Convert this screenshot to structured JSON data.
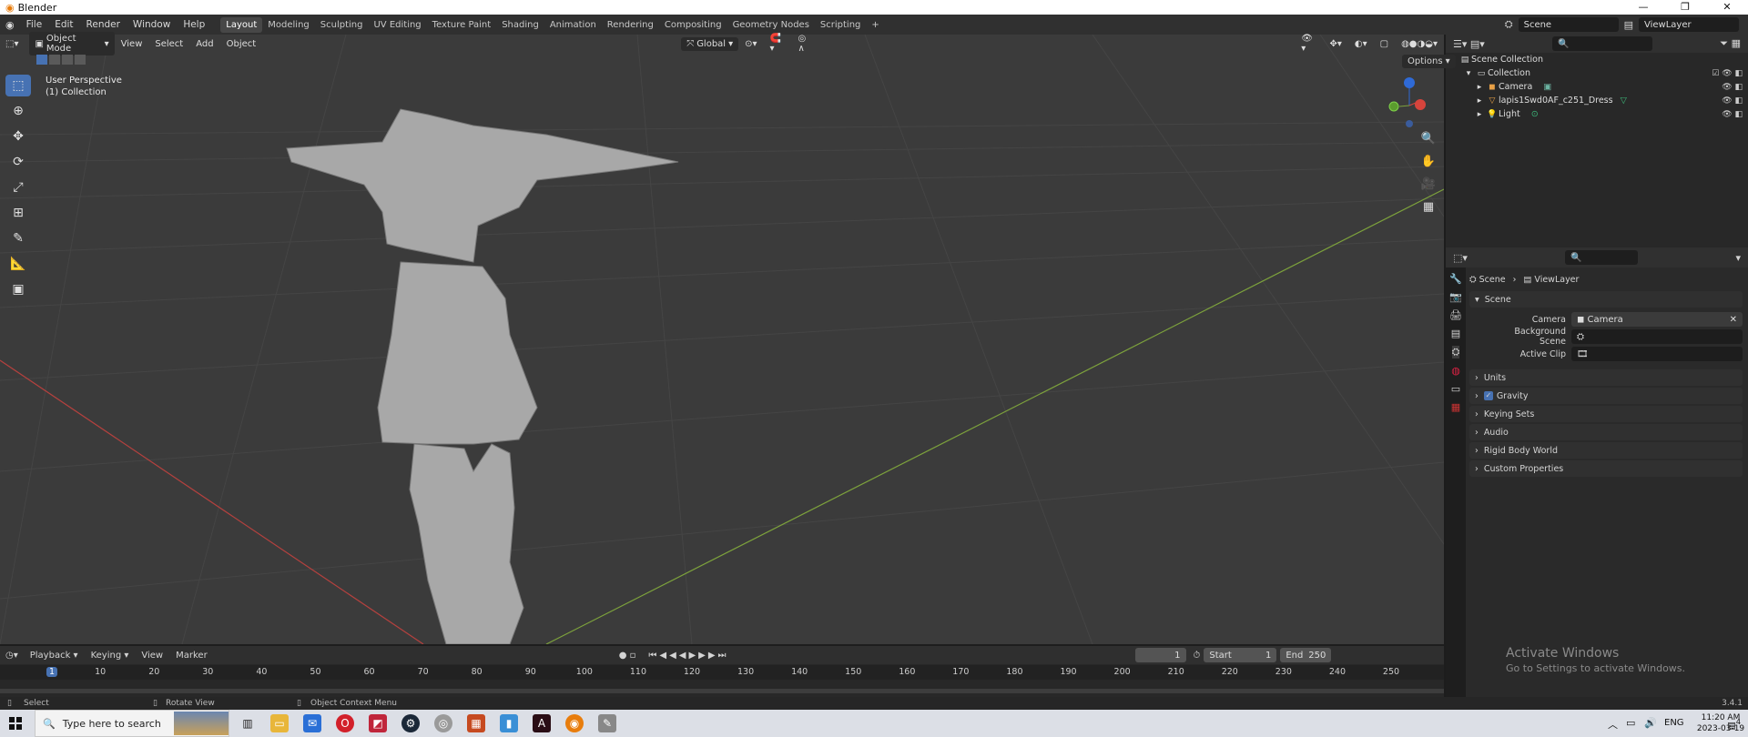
{
  "window": {
    "title": "Blender",
    "controls": [
      "—",
      "❐",
      "✕"
    ]
  },
  "menu": {
    "items": [
      "File",
      "Edit",
      "Render",
      "Window",
      "Help"
    ],
    "workspaces": [
      "Layout",
      "Modeling",
      "Sculpting",
      "UV Editing",
      "Texture Paint",
      "Shading",
      "Animation",
      "Rendering",
      "Compositing",
      "Geometry Nodes",
      "Scripting",
      "+"
    ],
    "active_workspace": "Layout",
    "scene_field": "Scene",
    "viewlayer_field": "ViewLayer"
  },
  "viewport": {
    "mode": "Object Mode",
    "menus": [
      "View",
      "Select",
      "Add",
      "Object"
    ],
    "orientation": "Global",
    "options_label": "Options",
    "overlay_line1": "User Perspective",
    "overlay_line2": "(1) Collection",
    "gizmo": {
      "z": "Z",
      "y": "Y",
      "x": "X"
    }
  },
  "outliner": {
    "root": "Scene Collection",
    "collection": "Collection",
    "items": [
      {
        "name": "Camera",
        "icon": "camera-icon"
      },
      {
        "name": "lapis1Swd0AF_c251_Dress",
        "icon": "mesh-icon"
      },
      {
        "name": "Light",
        "icon": "light-icon"
      }
    ]
  },
  "properties": {
    "breadcrumb_scene": "Scene",
    "breadcrumb_viewlayer": "ViewLayer",
    "panel_title": "Scene",
    "camera_label": "Camera",
    "camera_value": "Camera",
    "background_label": "Background Scene",
    "clip_label": "Active Clip",
    "sections": [
      "Units",
      "Gravity",
      "Keying Sets",
      "Audio",
      "Rigid Body World",
      "Custom Properties"
    ],
    "gravity_checked": true
  },
  "timeline": {
    "menus": [
      "Playback",
      "Keying",
      "View",
      "Marker"
    ],
    "current_frame": "1",
    "start_label": "Start",
    "start": "1",
    "end_label": "End",
    "end": "250",
    "ruler": [
      "1",
      "10",
      "20",
      "30",
      "40",
      "50",
      "60",
      "70",
      "80",
      "90",
      "100",
      "110",
      "120",
      "130",
      "140",
      "150",
      "160",
      "170",
      "180",
      "190",
      "200",
      "210",
      "220",
      "230",
      "240",
      "250"
    ]
  },
  "status": {
    "left": "Select",
    "mid": "Rotate View",
    "right": "Object Context Menu",
    "version": "3.4.1"
  },
  "watermark": {
    "line1": "Activate Windows",
    "line2": "Go to Settings to activate Windows."
  },
  "taskbar": {
    "search_placeholder": "Type here to search",
    "lang": "ENG",
    "time": "11:20 AM",
    "date": "2023-03-19",
    "notifications": "4"
  },
  "colors": {
    "accent": "#4772b3",
    "viewport": "#3b3b3b",
    "x_axis": "#b5413e",
    "y_axis": "#7da23c"
  }
}
